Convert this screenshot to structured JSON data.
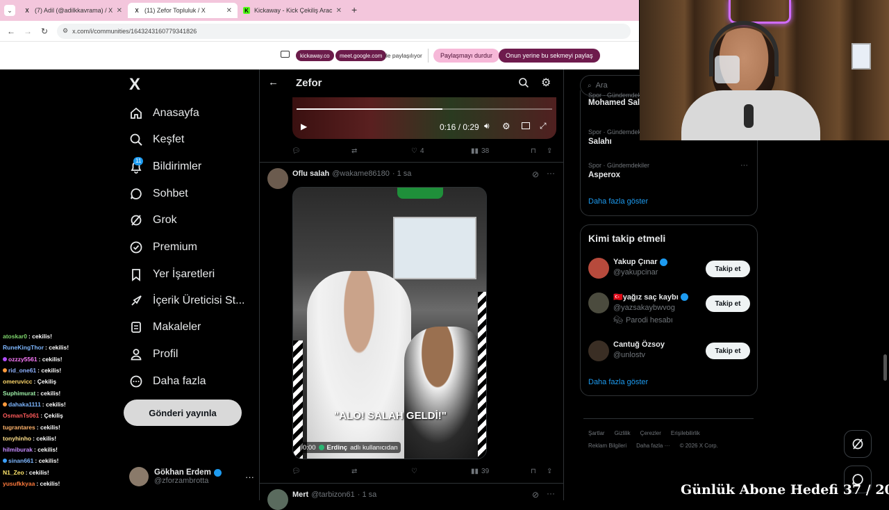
{
  "browser": {
    "tabs": [
      {
        "label": "(7) Adil (@adilkkavrama) / X",
        "favicon": "X",
        "active": false
      },
      {
        "label": "(11) Zefor Topluluk / X",
        "favicon": "X",
        "active": true
      },
      {
        "label": "Kickaway - Kick Çekiliş Aracı",
        "favicon": "K",
        "active": false
      }
    ],
    "new_tab": "+",
    "url": "x.com/i/communities/1643243160779341826",
    "share": {
      "domain1": "kickaway.co",
      "domain2": "meet.google.com",
      "text": "ile paylaşılıyor",
      "stop": "Paylaşmayı durdur",
      "share_this": "Onun yerine bu sekmeyi paylaş"
    }
  },
  "nav": {
    "logo": "X",
    "items": [
      {
        "label": "Anasayfa",
        "icon": "home-icon"
      },
      {
        "label": "Keşfet",
        "icon": "search-icon"
      },
      {
        "label": "Bildirimler",
        "icon": "bell-icon",
        "badge": "11"
      },
      {
        "label": "Sohbet",
        "icon": "chat-icon"
      },
      {
        "label": "Grok",
        "icon": "grok-icon"
      },
      {
        "label": "Premium",
        "icon": "premium-icon"
      },
      {
        "label": "Yer İşaretleri",
        "icon": "bookmark-icon"
      },
      {
        "label": "İçerik Üreticisi St...",
        "icon": "rocket-icon"
      },
      {
        "label": "Makaleler",
        "icon": "article-icon"
      },
      {
        "label": "Profil",
        "icon": "person-icon"
      },
      {
        "label": "Daha fazla",
        "icon": "more-circle-icon"
      }
    ],
    "post_button": "Gönderi yayınla",
    "profile": {
      "name": "Gökhan Erdem",
      "handle": "@zforzambrotta",
      "more": "···"
    }
  },
  "chat": [
    {
      "user": "atoskar0",
      "msg": ": cekilis!",
      "color": "#7fd66d"
    },
    {
      "user": "RuneKingThor",
      "msg": ": cekilis!",
      "color": "#7eb7ff"
    },
    {
      "user": "ozzzy5561",
      "msg": ": cekilis!",
      "color": "#ff7bff",
      "badge": "#b34dff"
    },
    {
      "user": "rid_one61",
      "msg": ": cekilis!",
      "color": "#8fb2ff",
      "badge": "#ff9a3c"
    },
    {
      "user": "omeruvicc",
      "msg": ": Çekiliş",
      "color": "#ffd86b"
    },
    {
      "user": "Suphimurat",
      "msg": ": cekilis!",
      "color": "#9ef0a8"
    },
    {
      "user": "dahaka1111",
      "msg": ": cekilis!",
      "color": "#7eb7ff",
      "badge": "#ff9a3c"
    },
    {
      "user": "OsmanTs061",
      "msg": ": Çekiliş",
      "color": "#ff5a5a"
    },
    {
      "user": "tugrantares",
      "msg": ": cekilis!",
      "color": "#ffb36b"
    },
    {
      "user": "tonyhinho",
      "msg": ": cekilis!",
      "color": "#ffe08a"
    },
    {
      "user": "hilmiburak",
      "msg": ": cekilis!",
      "color": "#c58cff"
    },
    {
      "user": "sinan661",
      "msg": ": cekilis!",
      "color": "#7eb7ff",
      "badge": "#3ca0ff"
    },
    {
      "user": "N1_Zeo",
      "msg": ": cekilis!",
      "color": "#ffe66b"
    },
    {
      "user": "yusufkkyaa",
      "msg": ": cekilis!",
      "color": "#ff7a3c"
    }
  ],
  "feed": {
    "title": "Zefor",
    "video1": {
      "time": "0:16 / 0:29"
    },
    "tweet1_actions": {
      "reply": "",
      "retweet": "",
      "likes": "4",
      "views": "38"
    },
    "tweet2": {
      "name": "Oflu salah",
      "handle": "@wakame86180",
      "time": "· 1 sa",
      "caption": "\"ALO! SALAH GELDİ!\"",
      "video_time": "0:00",
      "credit_name": "Erdinç",
      "credit_suffix": "adlı kullanıcıdan",
      "views": "39"
    },
    "tweet3": {
      "name": "Mert",
      "handle": "@tarbizon61",
      "time": "· 1 sa"
    }
  },
  "sidebar": {
    "search_placeholder": "Ara",
    "trends": [
      {
        "category": "Spor · Gündemdekiler",
        "name": "Mohamed Salah"
      },
      {
        "category": "Spor · Gündemdekiler",
        "name": "Salahı"
      },
      {
        "category": "Spor · Gündemdekiler",
        "name": "Asperox"
      }
    ],
    "show_more": "Daha fazla göster",
    "who_to_follow": {
      "title": "Kimi takip etmeli",
      "people": [
        {
          "name": "Yakup Çınar",
          "handle": "@yakupcinar",
          "button": "Takip et"
        },
        {
          "name": "🇹🇷yağız saç kaybı",
          "handle": "@yazsakaybwvog",
          "note": "Parodi hesabı",
          "button": "Takip et"
        },
        {
          "name": "Cantuğ Özsoy",
          "handle": "@unlostv",
          "button": "Takip et"
        }
      ],
      "show_more": "Daha fazla göster"
    },
    "footer": {
      "row1": [
        "Şartlar",
        "Gizlilik",
        "Çerezler",
        "Erişilebilirlik"
      ],
      "row2": [
        "Reklam Bilgileri",
        "Daha fazla ···",
        "© 2026 X Corp."
      ]
    }
  },
  "overlay": {
    "goal": "Günlük Abone Hedefi 37 / 20"
  }
}
